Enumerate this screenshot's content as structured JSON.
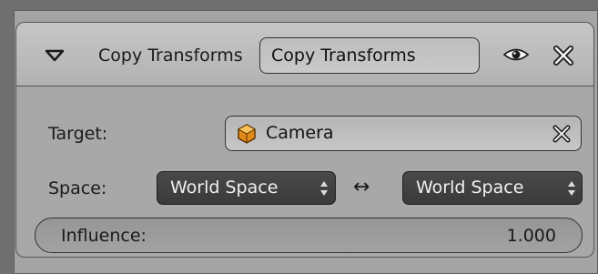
{
  "header": {
    "constraint_type": "Copy Transforms",
    "name_value": "Copy Transforms",
    "icons": {
      "collapse": "triangle-down-icon",
      "visibility": "eye-icon",
      "delete": "close-x-icon"
    }
  },
  "target": {
    "label": "Target:",
    "value": "Camera",
    "icon": "camera-object-icon"
  },
  "space": {
    "label": "Space:",
    "owner_space": "World Space",
    "target_space": "World Space",
    "separator": "↔"
  },
  "influence": {
    "label": "Influence:",
    "value": "1.000"
  },
  "colors": {
    "panel": "#a8a8a8",
    "header": "#c0c0c0",
    "select_bg": "#414141",
    "select_text": "#f0f0f0"
  }
}
